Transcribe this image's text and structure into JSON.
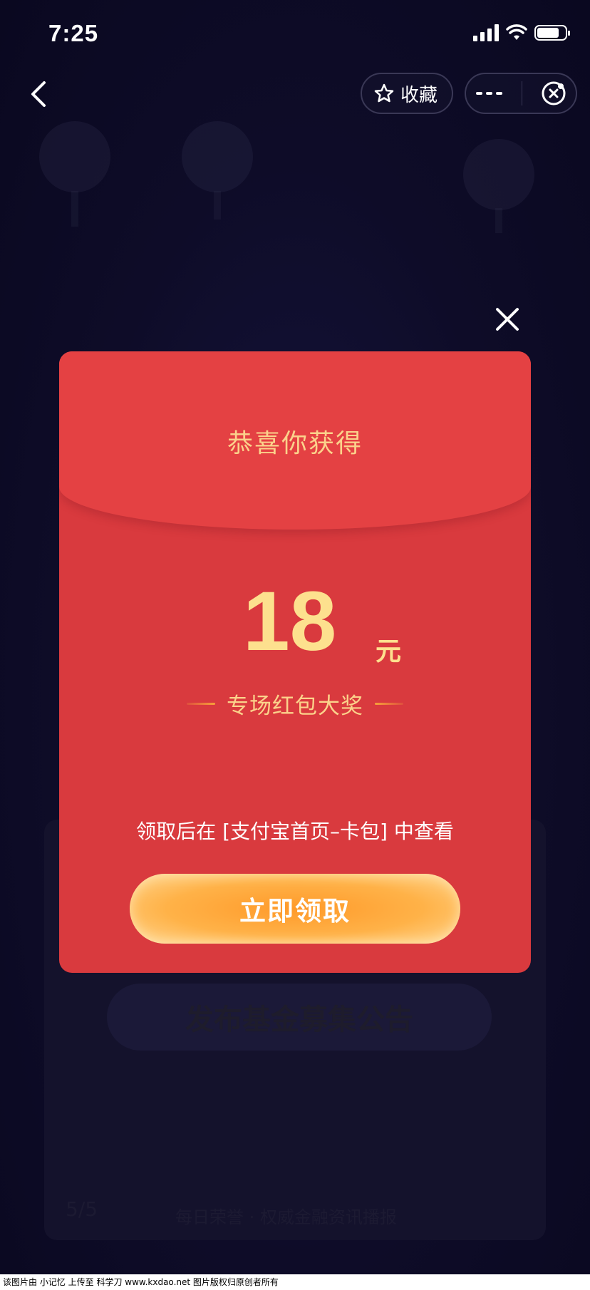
{
  "status_bar": {
    "time": "7:25"
  },
  "nav": {
    "favorite_label": "收藏"
  },
  "background": {
    "button_label": "发布基金募集公告",
    "page_indicator": "5/5",
    "footer_text": "每日荣誉 · 权威金融资讯播报"
  },
  "modal": {
    "title": "恭喜你获得",
    "amount": "18",
    "unit": "元",
    "prize_name": "专场红包大奖",
    "hint": "领取后在 [支付宝首页–卡包] 中查看",
    "claim_button": "立即领取"
  },
  "watermark": "该图片由 小记忆 上传至 科学刀 www.kxdao.net 图片版权归原创者所有",
  "colors": {
    "packet_red": "#d93a3e",
    "gold_text": "#fde08e",
    "button_orange": "#ffa43a"
  }
}
